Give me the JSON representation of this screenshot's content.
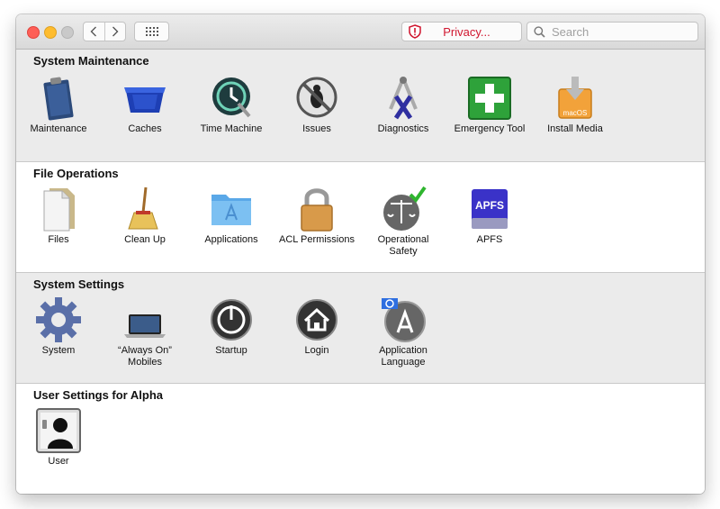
{
  "toolbar": {
    "privacy_label": "Privacy...",
    "search_placeholder": "Search"
  },
  "sections": [
    {
      "title": "System Maintenance",
      "items": [
        {
          "label": "Maintenance",
          "icon": "clipboard-icon"
        },
        {
          "label": "Caches",
          "icon": "bin-icon"
        },
        {
          "label": "Time Machine",
          "icon": "time-machine-icon"
        },
        {
          "label": "Issues",
          "icon": "bug-icon"
        },
        {
          "label": "Diagnostics",
          "icon": "caliper-icon"
        },
        {
          "label": "Emergency Tool",
          "icon": "first-aid-icon"
        },
        {
          "label": "Install Media",
          "icon": "install-disk-icon"
        }
      ]
    },
    {
      "title": "File Operations",
      "items": [
        {
          "label": "Files",
          "icon": "document-icon"
        },
        {
          "label": "Clean Up",
          "icon": "broom-icon"
        },
        {
          "label": "Applications",
          "icon": "applications-folder-icon"
        },
        {
          "label": "ACL Permissions",
          "icon": "padlock-icon"
        },
        {
          "label": "Operational\nSafety",
          "icon": "scales-icon"
        },
        {
          "label": "APFS",
          "icon": "apfs-drive-icon"
        }
      ]
    },
    {
      "title": "System Settings",
      "items": [
        {
          "label": "System",
          "icon": "gear-icon"
        },
        {
          "label": "“Always On”\nMobiles",
          "icon": "laptop-icon"
        },
        {
          "label": "Startup",
          "icon": "power-icon"
        },
        {
          "label": "Login",
          "icon": "home-icon"
        },
        {
          "label": "Application\nLanguage",
          "icon": "app-store-icon"
        }
      ]
    },
    {
      "title": "User Settings for Alpha",
      "items": [
        {
          "label": "User",
          "icon": "user-silhouette-icon"
        }
      ]
    }
  ],
  "apfs_badge": "APFS",
  "install_badge": "macOS",
  "colors": {
    "privacy_red": "#d0152e",
    "section_gray": "#ebebeb",
    "emergency_green": "#2ea23a"
  }
}
